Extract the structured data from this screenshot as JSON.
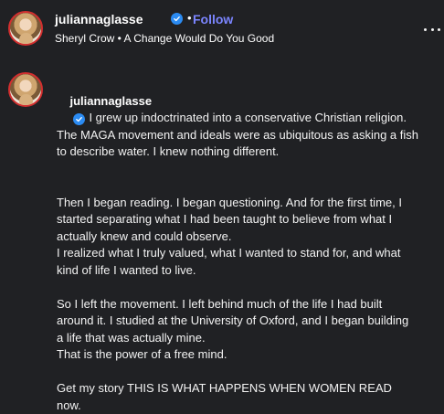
{
  "header": {
    "username": "juliannaglasse",
    "separator": "•",
    "follow_label": "Follow",
    "audio": "Sheryl Crow • A Change Would Do You Good"
  },
  "post": {
    "username": "juliannaglasse",
    "paragraph1": "I grew up indoctrinated into a conservative Christian religion. The MAGA movement and ideals were as ubiquitous as asking a fish to describe water. I knew nothing different.",
    "paragraph2": "Then I began reading. I began questioning. And for the first time, I started separating what I had been taught to believe from what I actually knew and could observe.\nI realized what I truly valued, what I wanted to stand for, and what kind of life I wanted to live.",
    "paragraph3": "So I left the movement. I left behind much of the life I had built around it. I studied at the University of Oxford, and I began building a life that was actually mine.\nThat is the power of a free mind.",
    "paragraph4": "Get my story THIS IS WHAT HAPPENS WHEN WOMEN READ now."
  },
  "icons": {
    "verified": "verified-badge-icon",
    "more": "more-options-icon"
  },
  "colors": {
    "background": "#202124",
    "follow": "#7b85ff",
    "verified": "#2b8bf2",
    "avatar_ring": "#d32f2f"
  }
}
